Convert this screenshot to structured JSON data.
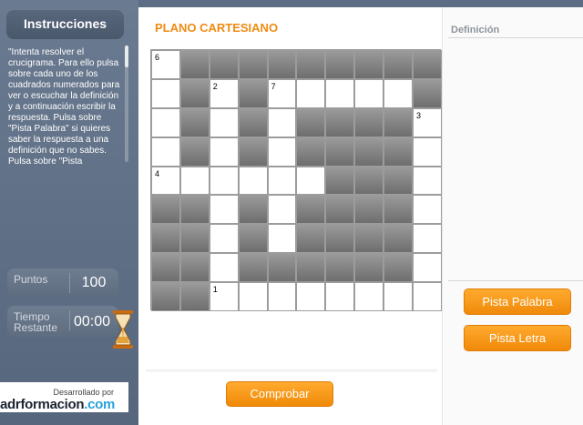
{
  "sidebar": {
    "instructions_title": "Instrucciones",
    "instructions_text": "\"Intenta resolver el crucigrama. Para ello pulsa sobre cada uno de los cuadrados numerados para ver o escuchar la definición y a continuación escribir la respuesta. Pulsa sobre \"Pista Palabra\" si quieres saber la respuesta a una definición que no sabes. Pulsa sobre \"Pista",
    "points_label": "Puntos",
    "points_value": "100",
    "time_label": "Tiempo Restante",
    "time_value": "00:00",
    "brand_small": "Desarrollado por",
    "brand_name_a": "adrformacion",
    "brand_name_b": ".com"
  },
  "main": {
    "title": "PLANO CARTESIANO",
    "check_button": "Comprobar"
  },
  "grid": {
    "rows": [
      [
        "w6",
        "d",
        "d",
        "d",
        "d",
        "d",
        "d",
        "d",
        "d",
        "d"
      ],
      [
        "w",
        "d",
        "w2",
        "d",
        "w7",
        "w",
        "w",
        "w",
        "w",
        "d"
      ],
      [
        "w",
        "d",
        "w",
        "d",
        "w",
        "d",
        "d",
        "d",
        "d",
        "w3"
      ],
      [
        "w",
        "d",
        "w",
        "d",
        "w",
        "d",
        "d",
        "d",
        "d",
        "w"
      ],
      [
        "w4",
        "w",
        "w",
        "w",
        "w",
        "w",
        "d",
        "d",
        "d",
        "w"
      ],
      [
        "d",
        "d",
        "w",
        "d",
        "w",
        "d",
        "d",
        "d",
        "d",
        "w"
      ],
      [
        "d",
        "d",
        "w",
        "d",
        "w",
        "d",
        "d",
        "d",
        "d",
        "w"
      ],
      [
        "d",
        "d",
        "w",
        "d",
        "d",
        "d",
        "d",
        "d",
        "d",
        "w"
      ],
      [
        "d",
        "d",
        "w1",
        "w",
        "w",
        "w",
        "w",
        "w",
        "w",
        "w"
      ]
    ]
  },
  "right": {
    "definition_title": "Definición",
    "hint_word_button": "Pista Palabra",
    "hint_letter_button": "Pista Letra"
  },
  "colors": {
    "accent": "#f08b13",
    "sidebar": "#5d6d84"
  },
  "icons": {
    "timer": "hourglass-icon"
  }
}
